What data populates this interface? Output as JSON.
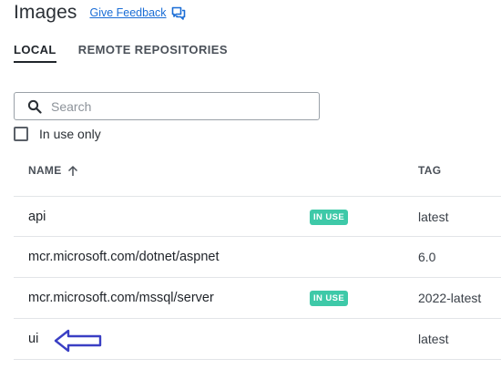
{
  "header": {
    "title": "Images",
    "feedback_label": "Give Feedback"
  },
  "tabs": [
    {
      "label": "LOCAL",
      "active": true
    },
    {
      "label": "REMOTE REPOSITORIES",
      "active": false
    }
  ],
  "search": {
    "placeholder": "Search",
    "value": ""
  },
  "filter": {
    "in_use_label": "In use only",
    "checked": false
  },
  "table": {
    "columns": {
      "name": "NAME",
      "tag": "TAG",
      "sort": "ascending"
    },
    "rows": [
      {
        "name": "api",
        "in_use": true,
        "badge": "IN USE",
        "tag": "latest"
      },
      {
        "name": "mcr.microsoft.com/dotnet/aspnet",
        "in_use": false,
        "badge": "",
        "tag": "6.0"
      },
      {
        "name": "mcr.microsoft.com/mssql/server",
        "in_use": true,
        "badge": "IN USE",
        "tag": "2022-latest"
      },
      {
        "name": "ui",
        "in_use": false,
        "badge": "",
        "tag": "latest"
      }
    ]
  },
  "colors": {
    "accent_link": "#1a6dd6",
    "in_use_badge": "#3ec9a8",
    "annotation_arrow": "#3a3fc4"
  },
  "icons": {
    "feedback": "chat-bubbles-icon",
    "search": "search-icon",
    "sort": "arrow-up-icon",
    "annotation": "arrow-left-icon"
  }
}
